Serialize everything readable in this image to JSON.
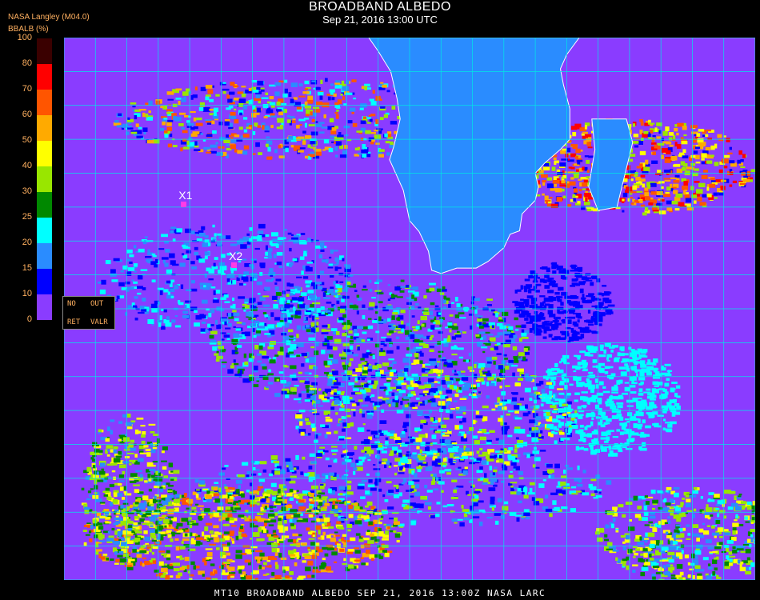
{
  "header": {
    "title": "BROADBAND ALBEDO",
    "subtitle": "Sep 21, 2016 13:00 UTC",
    "producer": "NASA Langley (M04.0)",
    "unit_label": "BBALB (%)"
  },
  "colorbar": {
    "ticks": [
      "100",
      "80",
      "70",
      "60",
      "50",
      "40",
      "30",
      "25",
      "20",
      "15",
      "10",
      "0"
    ],
    "segments": [
      {
        "from": 80,
        "to": 100,
        "color": "#3a0000"
      },
      {
        "from": 70,
        "to": 80,
        "color": "#ff0000"
      },
      {
        "from": 60,
        "to": 70,
        "color": "#ff5500"
      },
      {
        "from": 50,
        "to": 60,
        "color": "#ffaa00"
      },
      {
        "from": 40,
        "to": 50,
        "color": "#ffff00"
      },
      {
        "from": 30,
        "to": 40,
        "color": "#99e600"
      },
      {
        "from": 25,
        "to": 30,
        "color": "#008800"
      },
      {
        "from": 20,
        "to": 25,
        "color": "#00ffff"
      },
      {
        "from": 15,
        "to": 20,
        "color": "#2a8cff"
      },
      {
        "from": 10,
        "to": 15,
        "color": "#0000ff"
      },
      {
        "from": 0,
        "to": 10,
        "color": "#8a3cff"
      }
    ]
  },
  "legend_box": {
    "no": "NO",
    "out": "OUT",
    "ret": "RET",
    "valr": "VALR"
  },
  "markers": [
    {
      "id": "X1",
      "lat": -24.5,
      "lon": -21.0
    },
    {
      "id": "X2",
      "lat": -33.5,
      "lon": -13.0
    }
  ],
  "footer": "MT10  BROADBAND ALBEDO   SEP 21, 2016 13:00Z   NASA LARC",
  "grid": {
    "lon_min": -40,
    "lon_max": 70,
    "lon_step": 5,
    "lat_min": -80,
    "lat_max": 0,
    "lat_step": 5
  },
  "colors": {
    "ocean_clear": "#8a3cff",
    "land": "#2a8cff",
    "grid": "#00e6e6",
    "coast": "#ffffff"
  }
}
